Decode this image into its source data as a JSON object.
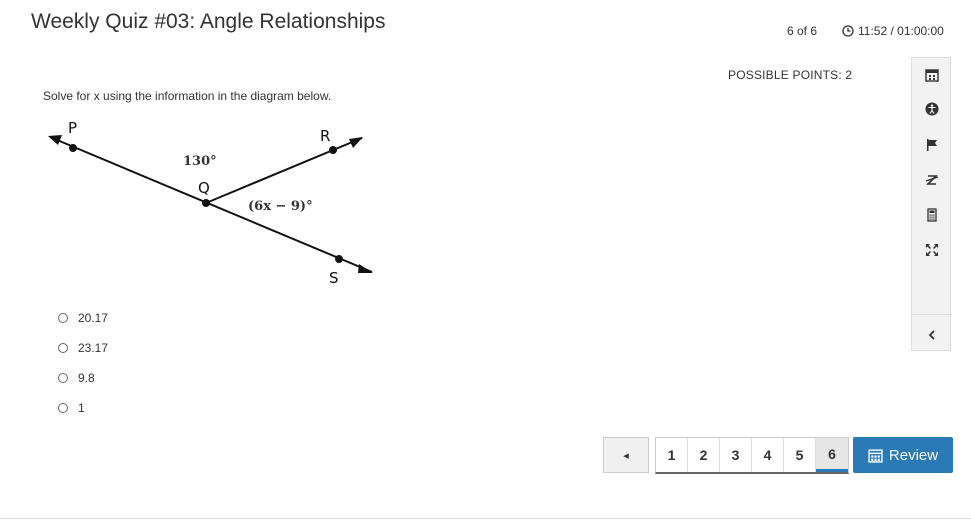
{
  "header": {
    "title": "Weekly Quiz #03: Angle Relationships",
    "counter": "6 of 6",
    "timer": "11:52 / 01:00:00"
  },
  "question": {
    "points": "POSSIBLE POINTS: 2",
    "prompt": "Solve for x using the information in the diagram below.",
    "diagram": {
      "label_p": "P",
      "label_r": "R",
      "label_q": "Q",
      "label_s": "S",
      "angle_1": "130°",
      "angle_2": "(6x − 9)°"
    },
    "choices": [
      "20.17",
      "23.17",
      "9.8",
      "1"
    ]
  },
  "toolbar": {
    "icons": [
      "calendar-icon",
      "accessibility-icon",
      "flag-icon",
      "strikethrough-icon",
      "calculator-icon",
      "expand-icon",
      "collapse-chevron-icon"
    ]
  },
  "pager": {
    "prev": "◂",
    "pages": [
      "1",
      "2",
      "3",
      "4",
      "5",
      "6"
    ],
    "active_page": "6",
    "review_label": "Review"
  },
  "colors": {
    "accent": "#2a7ab8",
    "toolbar_bg": "#f2f2f2"
  }
}
